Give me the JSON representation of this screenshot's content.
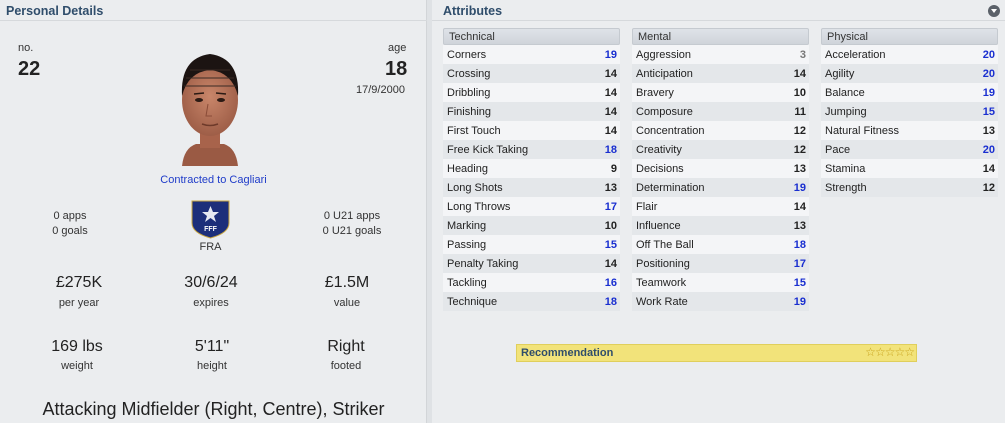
{
  "personal": {
    "title": "Personal Details",
    "no_label": "no.",
    "no_value": "22",
    "age_label": "age",
    "age_value": "18",
    "dob": "17/9/2000",
    "contract": "Contracted to Cagliari",
    "apps": "0 apps",
    "goals": "0 goals",
    "u21_apps": "0 U21 apps",
    "u21_goals": "0 U21 goals",
    "nation": "FRA",
    "crest_text": "FFF",
    "wage": "£275K",
    "wage_label": "per year",
    "expires": "30/6/24",
    "expires_label": "expires",
    "value": "£1.5M",
    "value_label": "value",
    "weight": "169 lbs",
    "weight_label": "weight",
    "height": "5'11\"",
    "height_label": "height",
    "foot": "Right",
    "foot_label": "footed",
    "position": "Attacking Midfielder (Right, Centre), Striker"
  },
  "attributes": {
    "title": "Attributes",
    "menu_icon": "chevron-down-circle-icon",
    "colors": {
      "high": "#1a2fd0",
      "mid": "#222222",
      "low": "#777777"
    },
    "columns": [
      {
        "name": "Technical",
        "items": [
          {
            "label": "Corners",
            "value": 19
          },
          {
            "label": "Crossing",
            "value": 14
          },
          {
            "label": "Dribbling",
            "value": 14
          },
          {
            "label": "Finishing",
            "value": 14
          },
          {
            "label": "First Touch",
            "value": 14
          },
          {
            "label": "Free Kick Taking",
            "value": 18
          },
          {
            "label": "Heading",
            "value": 9
          },
          {
            "label": "Long Shots",
            "value": 13
          },
          {
            "label": "Long Throws",
            "value": 17
          },
          {
            "label": "Marking",
            "value": 10
          },
          {
            "label": "Passing",
            "value": 15
          },
          {
            "label": "Penalty Taking",
            "value": 14
          },
          {
            "label": "Tackling",
            "value": 16
          },
          {
            "label": "Technique",
            "value": 18
          }
        ]
      },
      {
        "name": "Mental",
        "items": [
          {
            "label": "Aggression",
            "value": 3
          },
          {
            "label": "Anticipation",
            "value": 14
          },
          {
            "label": "Bravery",
            "value": 10
          },
          {
            "label": "Composure",
            "value": 11
          },
          {
            "label": "Concentration",
            "value": 12
          },
          {
            "label": "Creativity",
            "value": 12
          },
          {
            "label": "Decisions",
            "value": 13
          },
          {
            "label": "Determination",
            "value": 19
          },
          {
            "label": "Flair",
            "value": 14
          },
          {
            "label": "Influence",
            "value": 13
          },
          {
            "label": "Off The Ball",
            "value": 18
          },
          {
            "label": "Positioning",
            "value": 17
          },
          {
            "label": "Teamwork",
            "value": 15
          },
          {
            "label": "Work Rate",
            "value": 19
          }
        ]
      },
      {
        "name": "Physical",
        "items": [
          {
            "label": "Acceleration",
            "value": 20
          },
          {
            "label": "Agility",
            "value": 20
          },
          {
            "label": "Balance",
            "value": 19
          },
          {
            "label": "Jumping",
            "value": 15
          },
          {
            "label": "Natural Fitness",
            "value": 13
          },
          {
            "label": "Pace",
            "value": 20
          },
          {
            "label": "Stamina",
            "value": 14
          },
          {
            "label": "Strength",
            "value": 12
          }
        ]
      }
    ]
  },
  "recommendation": {
    "label": "Recommendation",
    "stars": 5,
    "star_icon": "star-icon"
  }
}
